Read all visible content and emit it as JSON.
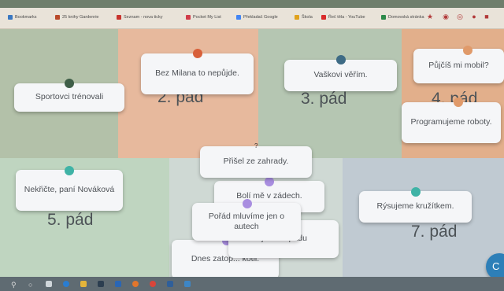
{
  "bookmarks": [
    {
      "label": "Bookmarks",
      "color": "#3a78c2"
    },
    {
      "label": "25 knihy Gardenrie",
      "color": "#b94a2a"
    },
    {
      "label": "Seznam - nova ticky",
      "color": "#c8342f"
    },
    {
      "label": "Pocket My List",
      "color": "#d13c4a"
    },
    {
      "label": "Překladač Google",
      "color": "#4285f4"
    },
    {
      "label": "Škola",
      "color": "#e0a21d"
    },
    {
      "label": "Řeč těla - YouTube",
      "color": "#d92b2b"
    },
    {
      "label": "Domovská stránka",
      "color": "#2c8a4a"
    }
  ],
  "zones": {
    "p2": {
      "label": "2. pád",
      "color": "#e9b99a"
    },
    "p3": {
      "label": "3. pád",
      "color": "#b6c7b3"
    },
    "p4": {
      "label": "4. pád",
      "color": "#e3b08a"
    },
    "p5": {
      "label": "5. pád",
      "color": "#bdd4bf"
    },
    "p7": {
      "label": "7. pád",
      "color": "#bfc9d1"
    }
  },
  "cards": {
    "sportovci": {
      "text": "Sportovci trénovali",
      "pin": "#3f5e48"
    },
    "milan": {
      "text": "Bez Milana to nepůjde.",
      "pin": "#d8603a"
    },
    "vasek": {
      "text": "Vaškovi věřím.",
      "pin": "#3e6b85"
    },
    "pujcis": {
      "text": "Půjčíš mi mobil?",
      "pin": "#e09a6a"
    },
    "programujeme": {
      "text": "Programujeme roboty.",
      "pin": "#e09a6a"
    },
    "prisel": {
      "text": "Přišel ze zahrady.",
      "marker": "?"
    },
    "boli": {
      "text": "Bolí mě v zádech.",
      "pin": "#a98ee0"
    },
    "nekficte": {
      "text": "Nekřičte, paní Nováková",
      "pin": "#3fb3a6"
    },
    "rysujeme": {
      "text": "Rýsujeme kružítkem.",
      "pin": "#3fb3a6"
    },
    "porad": {
      "text": "Pořád mluvíme jen o autech",
      "pin": "#a98ee0"
    },
    "napad": {
      "text": "me o jeho nápadu",
      "pin": "#a98ee0"
    },
    "dnes": {
      "text": "Dnes zatop... kotli.",
      "pin": "#a98ee0"
    }
  },
  "fab_label": "C"
}
